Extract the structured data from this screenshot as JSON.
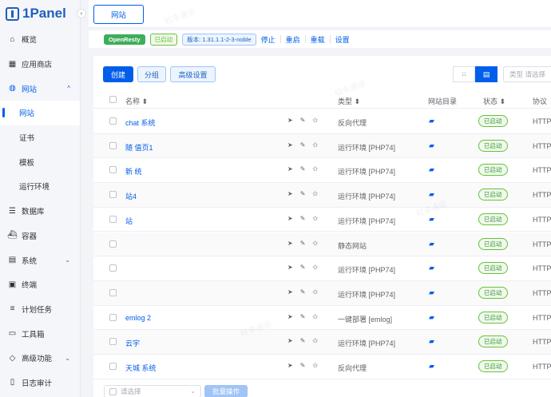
{
  "app": {
    "logo_text": "1Panel",
    "collapse_glyph": "‹"
  },
  "sidebar": {
    "items": [
      {
        "label": "概览",
        "icon": "home-icon"
      },
      {
        "label": "应用商店",
        "icon": "grid-icon"
      },
      {
        "label": "网站",
        "icon": "globe-icon",
        "expanded": true,
        "children": [
          {
            "label": "网站",
            "active": true
          },
          {
            "label": "证书"
          },
          {
            "label": "模板"
          },
          {
            "label": "运行环境"
          }
        ]
      },
      {
        "label": "数据库",
        "icon": "database-icon"
      },
      {
        "label": "容器",
        "icon": "container-icon"
      },
      {
        "label": "系统",
        "icon": "system-icon",
        "has_children": true
      },
      {
        "label": "终端",
        "icon": "terminal-icon"
      },
      {
        "label": "计划任务",
        "icon": "list-icon"
      },
      {
        "label": "工具箱",
        "icon": "toolbox-icon"
      },
      {
        "label": "高级功能",
        "icon": "diamond-icon",
        "has_children": true
      },
      {
        "label": "日志审计",
        "icon": "log-icon"
      }
    ]
  },
  "topbar": {
    "tab_label": "网站"
  },
  "statusbar": {
    "engine": "OpenResty",
    "state": "已启动",
    "version": "版本: 1.31.1.1-2-3-noble",
    "actions": [
      "停止",
      "重启",
      "重载",
      "设置"
    ]
  },
  "toolbar": {
    "create": "创建",
    "group": "分组",
    "advanced": "高级设置",
    "search_placeholder": "类型  请选择"
  },
  "table": {
    "columns": [
      "名称",
      "类型",
      "网站目录",
      "状态",
      "协议"
    ],
    "rows": [
      {
        "name": "chat 系统",
        "type": "反向代理",
        "status": "已启动",
        "protocol": "HTTP"
      },
      {
        "name": "随 值页1",
        "type": "运行环境 [PHP74]",
        "status": "已启动",
        "protocol": "HTTP"
      },
      {
        "name": "新 统",
        "type": "运行环境 [PHP74]",
        "status": "已启动",
        "protocol": "HTTP"
      },
      {
        "name": "站4",
        "type": "运行环境 [PHP74]",
        "status": "已启动",
        "protocol": "HTTP"
      },
      {
        "name": "站",
        "type": "运行环境 [PHP74]",
        "status": "已启动",
        "protocol": "HTTP"
      },
      {
        "name": "",
        "type": "静态网站",
        "status": "已启动",
        "protocol": "HTTP"
      },
      {
        "name": "",
        "type": "运行环境 [PHP74]",
        "status": "已启动",
        "protocol": "HTTP"
      },
      {
        "name": "",
        "type": "运行环境 [PHP74]",
        "status": "已启动",
        "protocol": "HTTP"
      },
      {
        "name": "emlog 2",
        "type": "一键部署 [emlog]",
        "status": "已启动",
        "protocol": "HTTP"
      },
      {
        "name": "云宇",
        "type": "运行环境 [PHP74]",
        "status": "已启动",
        "protocol": "HTTP"
      },
      {
        "name": "天城 系统",
        "type": "反向代理",
        "status": "已启动",
        "protocol": "HTTP"
      }
    ]
  },
  "bottom": {
    "select_placeholder": "请选择",
    "batch": "批量操作"
  },
  "watermark_text": "较丰通信"
}
